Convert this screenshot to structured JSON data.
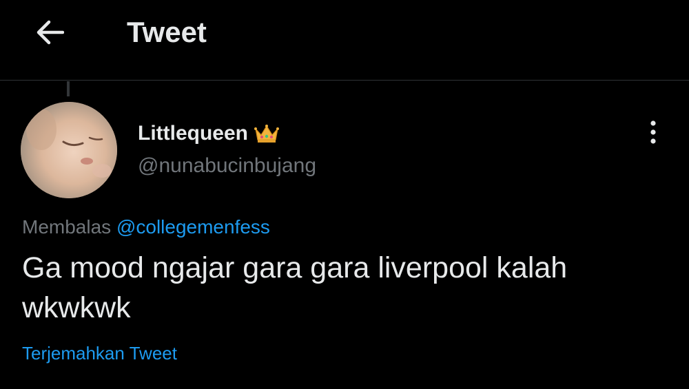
{
  "header": {
    "title": "Tweet",
    "back_icon": "arrow-left-icon"
  },
  "tweet": {
    "author": {
      "display_name": "Littlequeen",
      "handle": "@nunabucinbujang",
      "badge_icon": "crown-icon"
    },
    "more_icon": "more-vertical-icon",
    "reply_prefix": "Membalas",
    "reply_to": "@collegemenfess",
    "text": "Ga mood ngajar gara gara liverpool kalah wkwkwk",
    "translate_label": "Terjemahkan Tweet"
  },
  "colors": {
    "background": "#000000",
    "text_primary": "#e7e9ea",
    "text_secondary": "#71767b",
    "accent": "#1d9bf0",
    "divider": "#2f3336"
  }
}
